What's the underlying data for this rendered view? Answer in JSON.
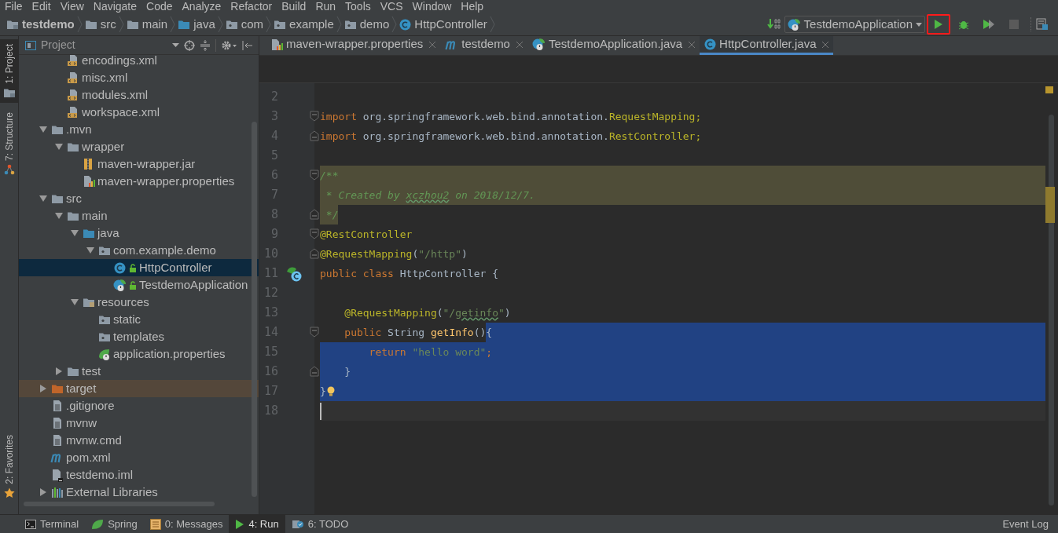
{
  "menu": [
    "File",
    "Edit",
    "View",
    "Navigate",
    "Code",
    "Analyze",
    "Refactor",
    "Build",
    "Run",
    "Tools",
    "VCS",
    "Window",
    "Help"
  ],
  "breadcrumbs": [
    {
      "label": "testdemo",
      "kind": "project"
    },
    {
      "label": "src",
      "kind": "folder"
    },
    {
      "label": "main",
      "kind": "folder"
    },
    {
      "label": "java",
      "kind": "source-folder"
    },
    {
      "label": "com",
      "kind": "package"
    },
    {
      "label": "example",
      "kind": "package"
    },
    {
      "label": "demo",
      "kind": "package"
    },
    {
      "label": "HttpController",
      "kind": "class"
    }
  ],
  "toolbar": {
    "run_config": "TestdemoApplication",
    "buttons": [
      {
        "kind": "run",
        "outlined": true,
        "disabled": false
      },
      {
        "kind": "debug",
        "outlined": false,
        "disabled": false
      },
      {
        "kind": "coverage",
        "outlined": false,
        "disabled": false
      },
      {
        "kind": "stop",
        "outlined": false,
        "disabled": true
      }
    ]
  },
  "left_stripe": {
    "top": [
      {
        "label": "1: Project",
        "kind": "project",
        "selected": true
      },
      {
        "label": "7: Structure",
        "kind": "structure",
        "selected": false
      }
    ],
    "bottom": [
      {
        "label": "2: Favorites",
        "kind": "star",
        "selected": false
      }
    ]
  },
  "project_panel": {
    "title": "Project",
    "tree": [
      {
        "children": [
          {
            "label": "encodings.xml",
            "kind": "xml",
            "selected": false,
            "hovered": false
          },
          {
            "label": "misc.xml",
            "kind": "xml",
            "selected": false,
            "hovered": false
          },
          {
            "label": "modules.xml",
            "kind": "xml",
            "selected": false,
            "hovered": false
          },
          {
            "label": "workspace.xml",
            "kind": "xml",
            "selected": false,
            "hovered": false
          }
        ]
      },
      {
        "label": ".mvn",
        "kind": "folder",
        "expanded": true,
        "selected": false,
        "hovered": false,
        "children": [
          {
            "label": "wrapper",
            "kind": "folder",
            "expanded": true,
            "selected": false,
            "hovered": false,
            "children": [
              {
                "label": "maven-wrapper.jar",
                "kind": "jar",
                "selected": false,
                "hovered": false
              },
              {
                "label": "maven-wrapper.properties",
                "kind": "properties",
                "selected": false,
                "hovered": false
              }
            ]
          }
        ]
      },
      {
        "label": "src",
        "kind": "folder",
        "expanded": true,
        "selected": false,
        "hovered": false,
        "children": [
          {
            "label": "main",
            "kind": "folder",
            "expanded": true,
            "selected": false,
            "hovered": false,
            "children": [
              {
                "label": "java",
                "kind": "source-folder",
                "expanded": true,
                "selected": false,
                "hovered": false,
                "children": [
                  {
                    "label": "com.example.demo",
                    "kind": "package",
                    "expanded": true,
                    "selected": false,
                    "hovered": false,
                    "children": [
                      {
                        "label": "HttpController",
                        "kind": "class",
                        "selected": true,
                        "hovered": false
                      },
                      {
                        "label": "TestdemoApplication",
                        "kind": "spring-class",
                        "selected": false,
                        "hovered": false
                      }
                    ]
                  }
                ]
              },
              {
                "label": "resources",
                "kind": "resources-folder",
                "expanded": true,
                "selected": false,
                "hovered": false,
                "children": [
                  {
                    "label": "static",
                    "kind": "package",
                    "selected": false,
                    "hovered": false
                  },
                  {
                    "label": "templates",
                    "kind": "package",
                    "selected": false,
                    "hovered": false
                  },
                  {
                    "label": "application.properties",
                    "kind": "spring-properties",
                    "selected": false,
                    "hovered": false
                  }
                ]
              }
            ]
          },
          {
            "label": "test",
            "kind": "folder",
            "expanded": false,
            "selected": false,
            "hovered": false
          }
        ]
      },
      {
        "label": "target",
        "kind": "excluded-folder",
        "expanded": false,
        "selected": false,
        "hovered": true
      },
      {
        "label": ".gitignore",
        "kind": "text-file",
        "selected": false,
        "hovered": false
      },
      {
        "label": "mvnw",
        "kind": "text-file",
        "selected": false,
        "hovered": false
      },
      {
        "label": "mvnw.cmd",
        "kind": "text-file",
        "selected": false,
        "hovered": false
      },
      {
        "label": "pom.xml",
        "kind": "maven",
        "selected": false,
        "hovered": false
      },
      {
        "label": "testdemo.iml",
        "kind": "iml",
        "selected": false,
        "hovered": false
      },
      {
        "label": "External Libraries",
        "kind": "libraries",
        "expanded": false,
        "selected": false,
        "hovered": false
      }
    ]
  },
  "editor_tabs": [
    {
      "label": "maven-wrapper.properties",
      "kind": "properties",
      "selected": false
    },
    {
      "label": "testdemo",
      "kind": "maven",
      "selected": false
    },
    {
      "label": "TestdemoApplication.java",
      "kind": "spring-class",
      "selected": false
    },
    {
      "label": "HttpController.java",
      "kind": "class",
      "selected": true
    }
  ],
  "code_lines": [
    {
      "number": "2",
      "kind": "plain"
    },
    {
      "number": "3",
      "kind": "plain",
      "marks": [
        {
          "kind": "fold-start"
        }
      ],
      "tokens": [
        {
          "text": "import",
          "kind": "keyword"
        },
        {
          "text": " org.springframework.web.bind.annotation.",
          "kind": "plain"
        },
        {
          "text": "RequestMapping;",
          "kind": "annotation"
        }
      ]
    },
    {
      "number": "4",
      "kind": "plain",
      "marks": [
        {
          "kind": "fold-end"
        }
      ],
      "tokens": [
        {
          "text": "import",
          "kind": "keyword"
        },
        {
          "text": " org.springframework.web.bind.annotation.",
          "kind": "plain"
        },
        {
          "text": "RestController;",
          "kind": "annotation"
        }
      ]
    },
    {
      "number": "5",
      "kind": "plain"
    },
    {
      "number": "6",
      "kind": "doc",
      "marks": [
        {
          "kind": "fold-start"
        }
      ],
      "tokens": [
        {
          "text": "/**",
          "kind": "doc"
        }
      ]
    },
    {
      "number": "7",
      "kind": "doc",
      "tokens": [
        {
          "text": " * Created by ",
          "kind": "doc"
        },
        {
          "text": "xczhou2",
          "kind": "doc-typo"
        },
        {
          "text": " on 2018/12/7.",
          "kind": "doc"
        }
      ]
    },
    {
      "number": "8",
      "kind": "doc-partial",
      "marks": [
        {
          "kind": "fold-end"
        }
      ],
      "tokens": [
        {
          "text": " */",
          "kind": "doc"
        }
      ]
    },
    {
      "number": "9",
      "kind": "plain",
      "marks": [
        {
          "kind": "fold-start"
        }
      ],
      "tokens": [
        {
          "text": "@RestController",
          "kind": "annotation"
        }
      ]
    },
    {
      "number": "10",
      "kind": "plain",
      "marks": [
        {
          "kind": "fold-end"
        }
      ],
      "tokens": [
        {
          "text": "@RequestMapping",
          "kind": "annotation"
        },
        {
          "text": "(",
          "kind": "plain"
        },
        {
          "text": "\"/http\"",
          "kind": "string"
        },
        {
          "text": ")",
          "kind": "plain"
        }
      ]
    },
    {
      "number": "11",
      "kind": "plain",
      "marks": [
        {
          "kind": "spring-bean"
        }
      ],
      "tokens": [
        {
          "text": "public",
          "kind": "keyword"
        },
        {
          "text": " class",
          "kind": "keyword"
        },
        {
          "text": " HttpController {",
          "kind": "plain"
        }
      ]
    },
    {
      "number": "12",
      "kind": "plain"
    },
    {
      "number": "13",
      "kind": "plain",
      "tokens": [
        {
          "text": "    @RequestMapping",
          "kind": "annotation"
        },
        {
          "text": "(",
          "kind": "plain"
        },
        {
          "text": "\"/",
          "kind": "string"
        },
        {
          "text": "getinfo",
          "kind": "string-typo"
        },
        {
          "text": "\"",
          "kind": "string"
        },
        {
          "text": ")",
          "kind": "plain"
        }
      ]
    },
    {
      "number": "14",
      "kind": "selected-partial",
      "marks": [
        {
          "kind": "fold-start"
        }
      ],
      "tokens": [
        {
          "text": "    public",
          "kind": "keyword",
          "selected": false
        },
        {
          "text": " String ",
          "kind": "plain",
          "selected": false
        },
        {
          "text": "getInfo",
          "kind": "method",
          "selected": false
        },
        {
          "text": "()",
          "kind": "plain",
          "selected": false
        },
        {
          "text": "{",
          "kind": "plain",
          "selected": true
        }
      ]
    },
    {
      "number": "15",
      "kind": "selected",
      "tokens": [
        {
          "text": "        return",
          "kind": "keyword"
        },
        {
          "text": " \"hello word\"",
          "kind": "string"
        },
        {
          "text": ";",
          "kind": "keyword"
        }
      ]
    },
    {
      "number": "16",
      "kind": "selected",
      "marks": [
        {
          "kind": "fold-end"
        }
      ],
      "tokens": [
        {
          "text": "    }",
          "kind": "plain"
        }
      ]
    },
    {
      "number": "17",
      "kind": "selected",
      "marks": [
        {
          "kind": "bulb"
        }
      ],
      "tokens": [
        {
          "text": "}",
          "kind": "plain"
        }
      ]
    },
    {
      "number": "18",
      "kind": "current",
      "marks": [
        {
          "kind": "caret"
        }
      ]
    }
  ],
  "bottom_bar": {
    "tools": [
      {
        "label": "Terminal",
        "kind": "terminal",
        "selected": false
      },
      {
        "label": "Spring",
        "kind": "spring",
        "selected": false
      },
      {
        "label": "0: Messages",
        "kind": "messages",
        "selected": false
      },
      {
        "label": "4: Run",
        "kind": "run",
        "selected": true
      },
      {
        "label": "6: TODO",
        "kind": "todo",
        "selected": false
      }
    ],
    "event_log": "Event Log"
  }
}
